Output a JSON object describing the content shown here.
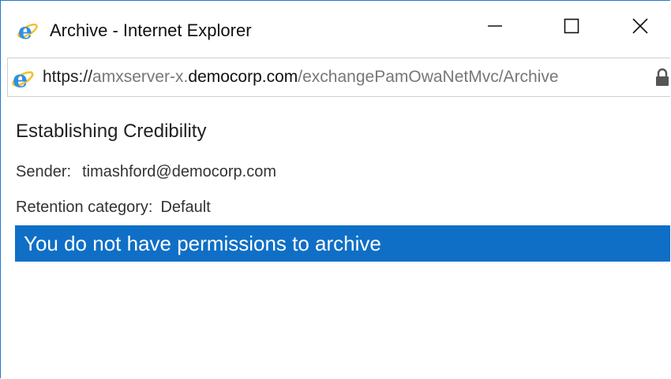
{
  "window": {
    "title": "Archive - Internet Explorer",
    "minimize_icon": "minimize-icon",
    "maximize_icon": "maximize-icon",
    "close_icon": "close-icon",
    "accent_color": "#1f7ad1"
  },
  "address_bar": {
    "scheme": "https://",
    "subdomain": "amxserver-x.",
    "domain": "democorp.com",
    "path": "/exchangePamOwaNetMvc/Archive",
    "browser_icon": "internet-explorer-icon",
    "security_icon": "lock-icon"
  },
  "message": {
    "subject": "Establishing Credibility",
    "sender_label": "Sender:",
    "sender_value": "timashford@democorp.com",
    "retention_label": "Retention category:",
    "retention_value": "Default"
  },
  "banner": {
    "text": "You do not have permissions to archive",
    "color": "#0f6fc6"
  }
}
